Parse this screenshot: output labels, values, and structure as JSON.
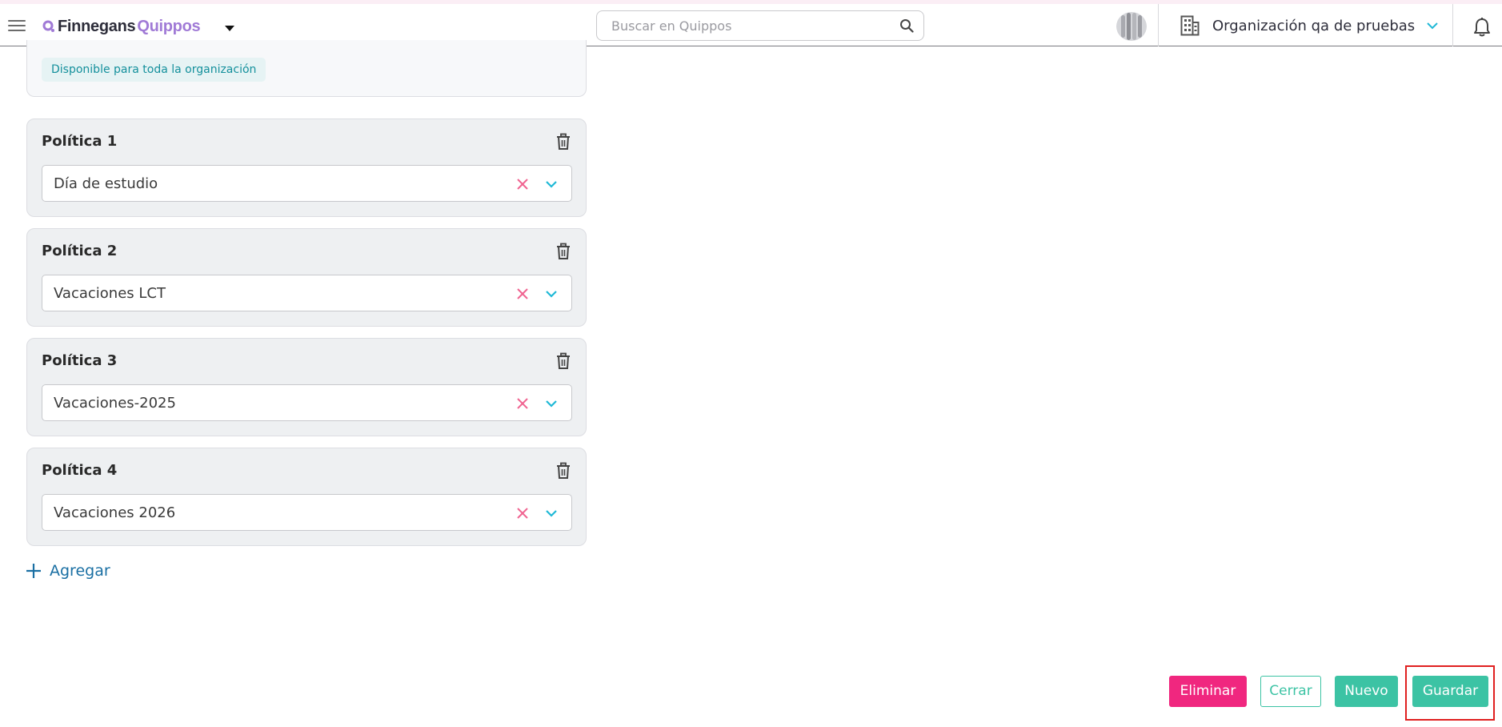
{
  "header": {
    "logo_primary": "Finnegans",
    "logo_secondary": "Quippos",
    "search": {
      "placeholder": "Buscar en Quippos",
      "value": ""
    },
    "organization": "Organización qa de pruebas"
  },
  "org_card": {
    "badge": "Disponible para toda la organización"
  },
  "policies": [
    {
      "title": "Política 1",
      "value": "Día de estudio"
    },
    {
      "title": "Política 2",
      "value": "Vacaciones LCT"
    },
    {
      "title": "Política 3",
      "value": "Vacaciones-2025"
    },
    {
      "title": "Política 4",
      "value": "Vacaciones 2026"
    }
  ],
  "add_label": "Agregar",
  "footer": {
    "delete_label": "Eliminar",
    "close_label": "Cerrar",
    "new_label": "Nuevo",
    "save_label": "Guardar"
  },
  "colors": {
    "accent": "#3cc3a4",
    "danger": "#f0277f",
    "brand_purple": "#a07ad6",
    "link_blue": "#1a6fa3",
    "chevron_cyan": "#1fb8d6",
    "clear_pink": "#f06491"
  }
}
